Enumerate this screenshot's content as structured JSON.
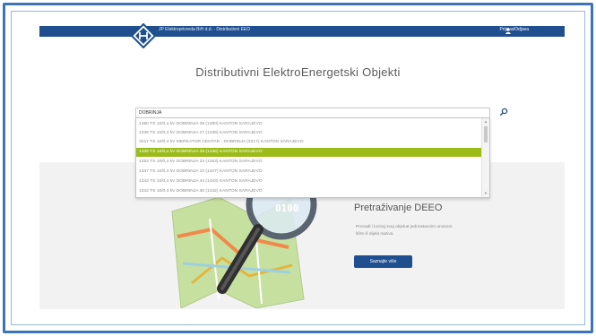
{
  "header": {
    "company": "JP Elektroprivreda BiH d.d. - Distributivni EEO",
    "login": "Prijava/Odjava",
    "login_icon": "user-icon"
  },
  "page_title": "Distributivni ElektroEnergetski Objekti",
  "search": {
    "value": "DOBRINJA",
    "icon": "search-icon"
  },
  "dropdown": {
    "items": [
      "1350 TS 10/0,4 kV DOBRINJA 38 (1350) KANTON SARAJEVO",
      "1339 TS 10/0,4 kV DOBRINJA 27 (1339) KANTON SARAJEVO",
      "3217 TS 10/0,4 kV MERKATOR CENTAR - DOBRINJA (3217) KANTON SARAJEVO",
      "1338 TS 10/0,4 kV DOBRINJA 39 (1338) KANTON SARAJEVO",
      "1253 TS 10/0,4 kV DOBRINJA 33 (1253) KANTON SARAJEVO",
      "1347 TS 10/0,4 kV DOBRINJA 10 (1347) KANTON SARAJEVO",
      "1343 TS 10/0,4 kV DOBRINJA 44 (1343) KANTON SARAJEVO",
      "1342 TS 10/0,4 kV DOBRINJA 30 (1342) KANTON SARAJEVO"
    ],
    "selected_index": 3
  },
  "hero": {
    "title": "Pretraživanje DEEO",
    "description": "Pronađi i locirај svoj objekat jednostavnim unosom šifre ili dijela naziva.",
    "button": "Saznajte više",
    "map_numbers": [
      "011010",
      "0100"
    ]
  },
  "colors": {
    "accent": "#1f4f8f",
    "selected": "#9bbc18",
    "frame": "#3d73b8"
  }
}
